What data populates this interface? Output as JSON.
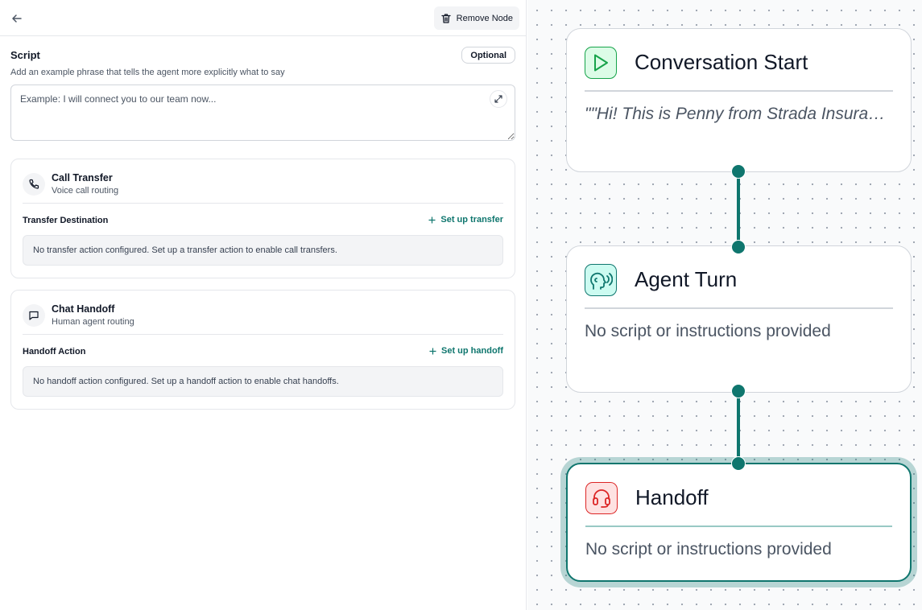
{
  "toolbar": {
    "remove_label": "Remove Node"
  },
  "script": {
    "title": "Script",
    "badge": "Optional",
    "description": "Add an example phrase that tells the agent more explicitly what to say",
    "placeholder": "Example: I will connect you to our team now...",
    "value": ""
  },
  "transfer": {
    "title": "Call Transfer",
    "subtitle": "Voice call routing",
    "label": "Transfer Destination",
    "action": "Set up transfer",
    "note": "No transfer action configured. Set up a transfer action to enable call transfers."
  },
  "handoff": {
    "title": "Chat Handoff",
    "subtitle": "Human agent routing",
    "label": "Handoff Action",
    "action": "Set up handoff",
    "note": "No handoff action configured. Set up a handoff action to enable chat handoffs."
  },
  "nodes": [
    {
      "title": "Conversation Start",
      "text": "\"\"Hi! This is Penny from Strada Insurance",
      "icon": "play-icon",
      "color": "#16a34a"
    },
    {
      "title": "Agent Turn",
      "text": "No script or instructions provided",
      "icon": "speaking-head-icon",
      "color": "#0f766e"
    },
    {
      "title": "Handoff",
      "text": "No script or instructions provided",
      "icon": "headset-icon",
      "color": "#dc2626",
      "selected": true
    }
  ],
  "colors": {
    "accent": "#0f766e",
    "start": "#16a34a",
    "handoff": "#dc2626"
  }
}
